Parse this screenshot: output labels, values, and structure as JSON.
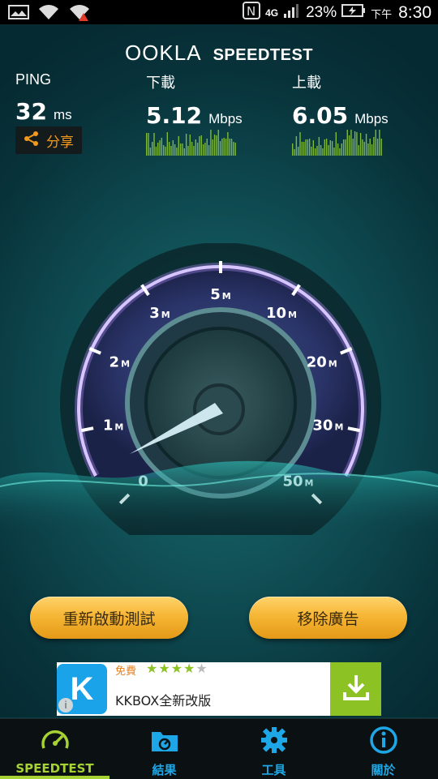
{
  "status_bar": {
    "battery_percent": "23%",
    "time_prefix": "下午",
    "time": "8:30",
    "network_label": "4G"
  },
  "header": {
    "logo_primary": "OOKLA",
    "logo_secondary": "SPEEDTEST"
  },
  "results": {
    "ping": {
      "label": "PING",
      "value": "32",
      "unit": "ms"
    },
    "download": {
      "label": "下載",
      "value": "5.12",
      "unit": "Mbps"
    },
    "upload": {
      "label": "上載",
      "value": "6.05",
      "unit": "Mbps"
    },
    "share_label": "分享"
  },
  "gauge": {
    "tick_labels": [
      "0",
      "1",
      "2",
      "3",
      "5",
      "10",
      "20",
      "30",
      "50"
    ],
    "tick_unit": "M",
    "needle_value": 0
  },
  "buttons": {
    "restart_label": "重新啟動測試",
    "remove_ads_label": "移除廣告"
  },
  "ad": {
    "free_label": "免費",
    "stars": "★★★★★",
    "title": "KKBOX全新改版",
    "logo_letter": "K",
    "info_label": "i"
  },
  "nav": {
    "items": [
      {
        "label": "SPEEDTEST",
        "icon": "speedometer-icon",
        "active": true
      },
      {
        "label": "結果",
        "icon": "results-folder-icon",
        "active": false
      },
      {
        "label": "工具",
        "icon": "gear-icon",
        "active": false
      },
      {
        "label": "關於",
        "icon": "info-icon",
        "active": false
      }
    ]
  },
  "colors": {
    "accent_orange": "#f39a1d",
    "nav_active": "#a6d233",
    "nav_inactive": "#1ea7e6",
    "spark_green": "#7fb93a",
    "button_gold": "#f6b636"
  }
}
